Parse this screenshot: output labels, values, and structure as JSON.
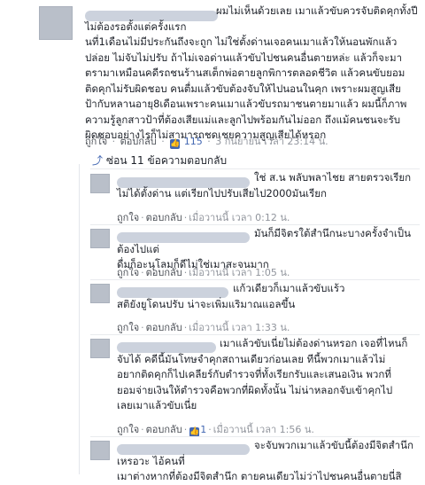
{
  "main_comment": {
    "text": "ผมไม่เห็นด้วยเลย เมาแล้วขับควรจับติดคุกทั้งปีไม่ต้องรอตั้งแต่ครั้งแรก\nนที่1เดือนไม่มีประกันถึงจะถูก ไม่ใช่ตั้งด่านเจอคนเมาแล้วให้นอนพักแล้ว\nปล่อย ไม่จับไม่ปรับ ถ้าไม่เจอด่านแล้วขับไปชนคนอื่นตายหล่ะ แล้วก็จะมา\nตรามาเหมือนคดีรถชนร้านสเต็กพ่อตายลูกพิการตลอดชีวิต แล้วคนขับยอม\nติดคุกไม่รับผิดชอบ คนตื่มแล้วขับต้องจับให้ไปนอนในคุก เพราะผมสูญเสีย\nป้ากับหลานอายุ8เดือนเพราะคนเมาแล้วขับรถมาชนตายมาแล้ว ผมนี้ก็ภาพ\nความรู้ลูกสาวป้าที่ต้องเสียแม่และลูกไปพร้อมกันไม่ออก ถึงแม้คนชนจะรับ\nผิดชอบอย่างไรก็ไม่สามารถชดเชยความสูญเสียได้หรอก",
    "actions": {
      "like": "ถูกใจ",
      "reply": "ตอบกลับ",
      "like_count": "115",
      "date": "3 กันยายน เวลา 23:14 น."
    }
  },
  "hide_replies": "ซ่อน 11 ข้อความตอบกลับ",
  "replies": [
    {
      "text": "ใช่ ส.น พลับพลาไชย สายตรวจเรียก\nไม่ได้ตั้งด่าน แต่เรียกไปปรับเสียไป2000มันเรียก",
      "like": "ถูกใจ",
      "reply": "ตอบกลับ",
      "time": "เมื่อวานนี้ เวลา 0:12 น."
    },
    {
      "text": "มันก็มีจิตรใต้สำนึกนะบางครั้งจำเป็นต้องไปแต่\nดื่มก็อะนุโลมก็ดีไม่ใช่เมาสะจนมาก",
      "like": "ถูกใจ",
      "reply": "ตอบกลับ",
      "time": "เมื่อวานนี้ เวลา 1:05 น."
    },
    {
      "text": "แก้วเดียวก็เมาแล้วขับแร้ว\nสติยังยูโดนปรับ น่าจะเพิ่มแริมาณแอลขึ้น",
      "like": "ถูกใจ",
      "reply": "ตอบกลับ",
      "time": "เมื่อวานนี้ เวลา 1:33 น."
    },
    {
      "text": "เมาแล้วขับเนี่ยไม่ต้องด่านหรอก เจอที่ไหนก็\nจับได้ คดีนี้มันโทษจำคุกสถานเดียวก่อนเลย ทีนี้พวกเมาแล้วไม่\nอยากติดคุกก็ไปเคลียร์กับตำรวจที่ทั้งเรียกรับและเสนอเงิน พวกที่\nยอมจ่ายเงินให้ตำรวจคือพวกที่ผิดทั้งนั้น ไม่น่าหลอกจับเข้าคุกไป\nเลยเมาแล้วขับเนี่ย",
      "like": "ถูกใจ",
      "reply": "ตอบกลับ",
      "like_count": "1",
      "time": "เมื่อวานนี้ เวลา 1:56 น."
    },
    {
      "text": "จะจับพวกเมาแล้วขับนี้ต้องมีจิตสำนึกเหรอวะ ไอ้คนที่\nเมาต่างหากที่ต้องมีจิตสำนึก ตายคนเดียวไม่ว่าไปชนคนอื่นตายนี่สิ"
    }
  ],
  "colors": {
    "link_blue": "#4267b2",
    "meta_gray": "#90949c",
    "text": "#1d2129"
  }
}
